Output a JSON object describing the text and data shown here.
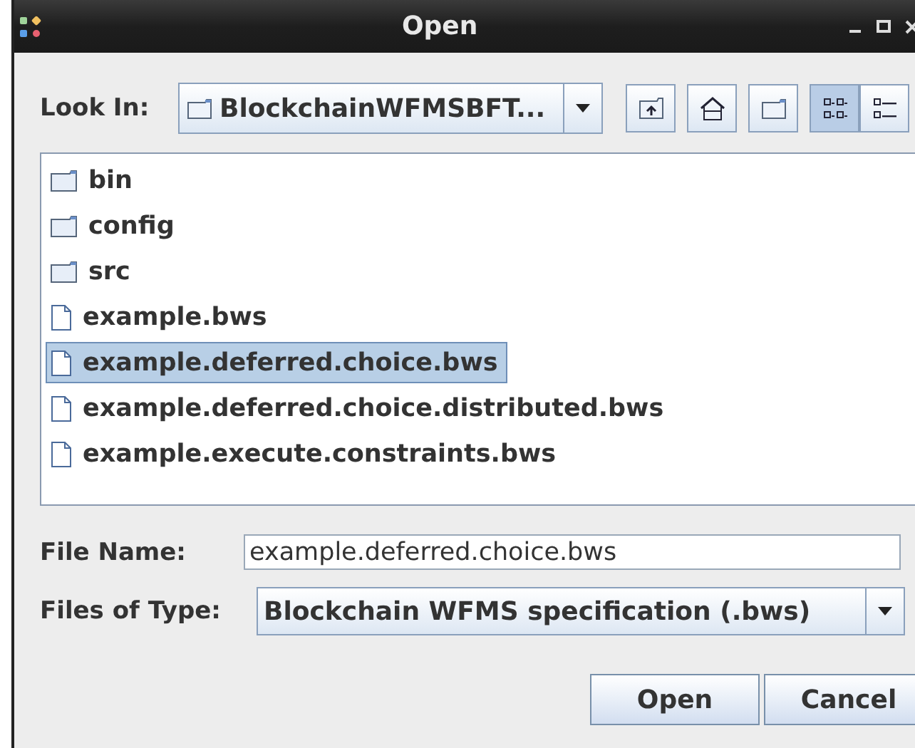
{
  "window": {
    "title": "Open"
  },
  "look_in": {
    "label": "Look In:",
    "value": "BlockchainWFMSBFT..."
  },
  "toolbar": [
    {
      "kind": "up",
      "selected": false
    },
    {
      "kind": "home",
      "selected": false
    },
    {
      "kind": "newfolder",
      "selected": false
    },
    {
      "kind": "list",
      "selected": true
    },
    {
      "kind": "details",
      "selected": false
    }
  ],
  "files": [
    {
      "name": "bin",
      "kind": "folder",
      "selected": false
    },
    {
      "name": "config",
      "kind": "folder",
      "selected": false
    },
    {
      "name": "src",
      "kind": "folder",
      "selected": false
    },
    {
      "name": "example.bws",
      "kind": "file",
      "selected": false
    },
    {
      "name": "example.deferred.choice.bws",
      "kind": "file",
      "selected": true
    },
    {
      "name": "example.deferred.choice.distributed.bws",
      "kind": "file",
      "selected": false
    },
    {
      "name": "example.execute.constraints.bws",
      "kind": "file",
      "selected": false
    }
  ],
  "file_name": {
    "label": "File Name:",
    "value": "example.deferred.choice.bws"
  },
  "file_type": {
    "label": "Files of Type:",
    "value": "Blockchain WFMS specification (.bws)"
  },
  "buttons": [
    "Open",
    "Cancel"
  ]
}
